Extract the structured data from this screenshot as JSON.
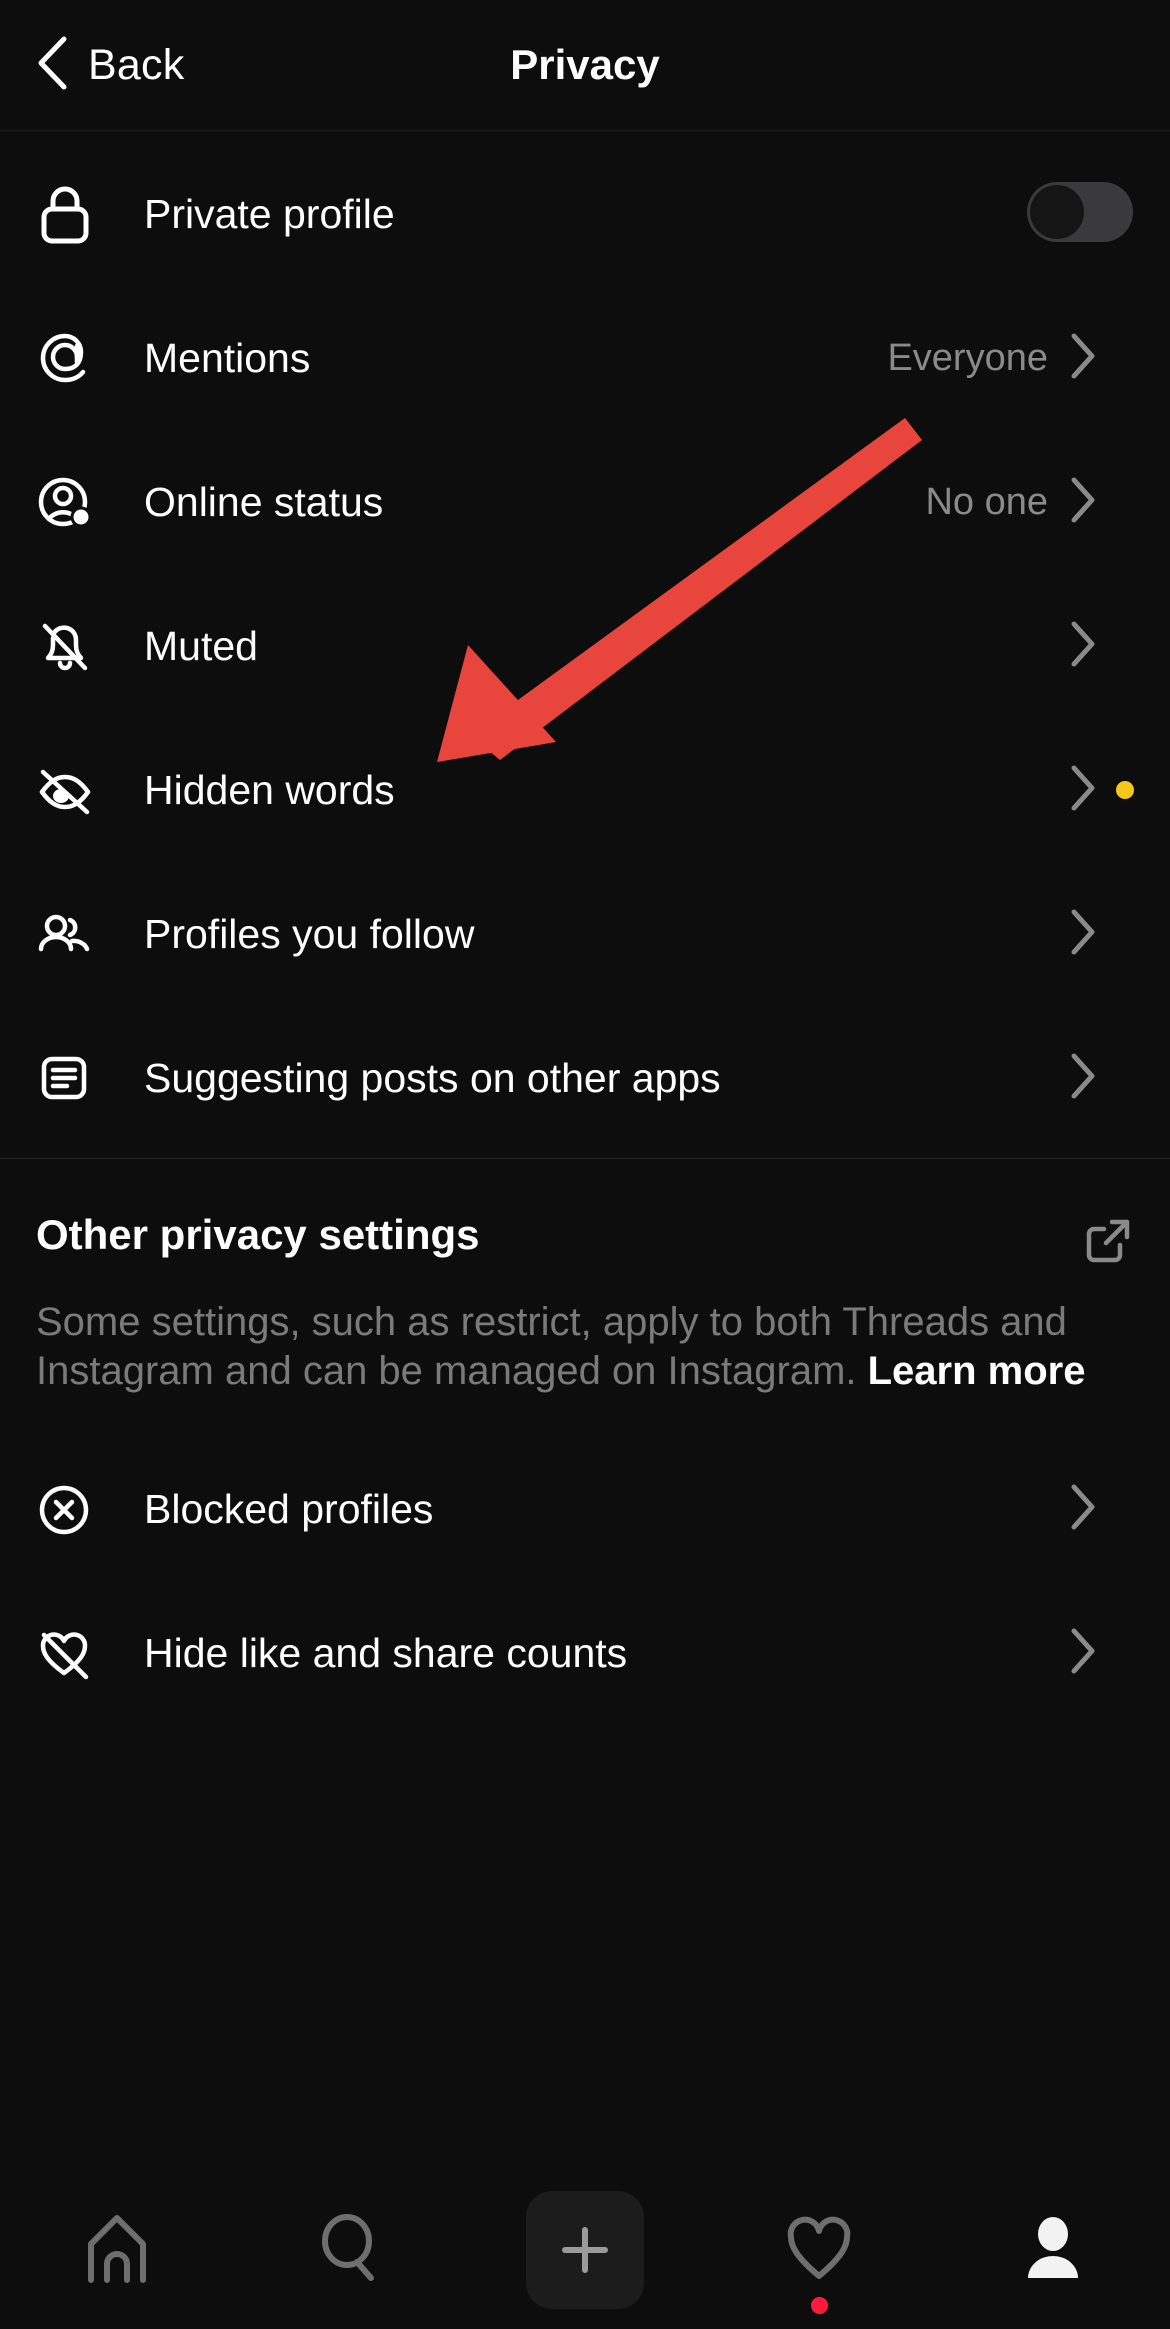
{
  "header": {
    "back_label": "Back",
    "title": "Privacy",
    "back_icon": "chevron-left-icon"
  },
  "settings": {
    "primary_items": [
      {
        "label": "Private profile",
        "icon": "lock-icon",
        "control": "toggle",
        "toggle_on": false
      },
      {
        "label": "Mentions",
        "icon": "threads-at-icon",
        "control": "chevron",
        "value": "Everyone"
      },
      {
        "label": "Online status",
        "icon": "online-status-icon",
        "control": "chevron",
        "value": "No one"
      },
      {
        "label": "Muted",
        "icon": "bell-slash-icon",
        "control": "chevron",
        "value": ""
      },
      {
        "label": "Hidden words",
        "icon": "eye-slash-icon",
        "control": "chevron",
        "value": "",
        "badge": true
      },
      {
        "label": "Profiles you follow",
        "icon": "two-people-icon",
        "control": "chevron",
        "value": ""
      },
      {
        "label": "Suggesting posts on other apps",
        "icon": "document-lines-icon",
        "control": "chevron",
        "value": ""
      }
    ],
    "other_section": {
      "title": "Other privacy settings",
      "external_icon": "external-link-icon",
      "description": "Some settings, such as restrict, apply to both Threads and Instagram and can be managed on Instagram. ",
      "learn_more": "Learn more",
      "items": [
        {
          "label": "Blocked profiles",
          "icon": "circle-x-icon",
          "control": "chevron",
          "value": ""
        },
        {
          "label": "Hide like and share counts",
          "icon": "heart-slash-icon",
          "control": "chevron",
          "value": ""
        }
      ]
    }
  },
  "annotation": {
    "type": "arrow",
    "color": "#E8453C",
    "points_to": "Hidden words"
  },
  "bottom_nav": {
    "items": [
      {
        "icon": "home-icon",
        "active": false
      },
      {
        "icon": "search-icon",
        "active": false
      },
      {
        "icon": "compose-plus-icon",
        "active": false
      },
      {
        "icon": "heart-icon",
        "active": false,
        "badge": true
      },
      {
        "icon": "profile-icon",
        "active": true
      }
    ]
  },
  "colors": {
    "background": "#0d0d0d",
    "text_primary": "#ffffff",
    "text_secondary": "#8a8a8a",
    "text_muted": "#7a7a7a",
    "divider": "#242424",
    "accent_arrow": "#E8453C",
    "badge_yellow": "#F5C518",
    "badge_red": "#FF1B3D",
    "toggle_track": "#3a3a3c",
    "nav_inactive": "#6e6e6e",
    "compose_bg": "#1c1c1c"
  }
}
